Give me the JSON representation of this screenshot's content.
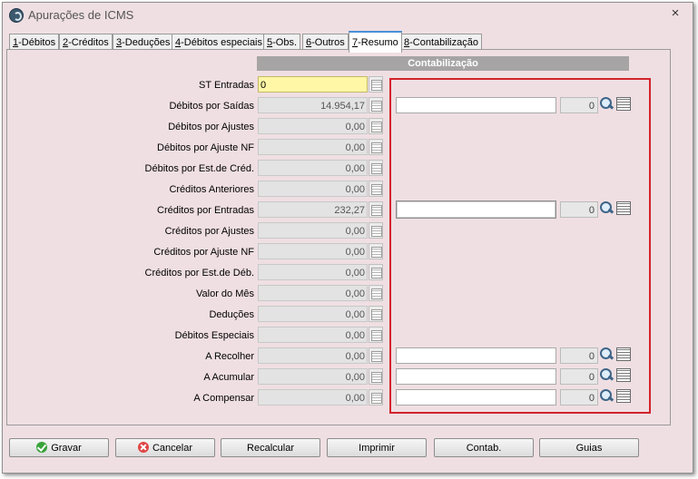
{
  "window": {
    "title": "Apurações de ICMS",
    "close_glyph": "×"
  },
  "tabs": [
    {
      "key": "1",
      "label": "-Débitos"
    },
    {
      "key": "2",
      "label": "-Créditos"
    },
    {
      "key": "3",
      "label": "-Deduções"
    },
    {
      "key": "4",
      "label": "-Débitos especiais"
    },
    {
      "key": "5",
      "label": "-Obs."
    },
    {
      "key": "6",
      "label": "-Outros"
    },
    {
      "key": "7",
      "label": "-Resumo"
    },
    {
      "key": "8",
      "label": "-Contabilização"
    }
  ],
  "active_tab": "7-Resumo",
  "section": {
    "header": "Contabilização"
  },
  "rows": [
    {
      "label": "ST Entradas",
      "value": "0"
    },
    {
      "label": "Débitos por Saídas",
      "value": "14.954,17",
      "account": "",
      "code": "0"
    },
    {
      "label": "Débitos por Ajustes",
      "value": "0,00"
    },
    {
      "label": "Débitos por Ajuste NF",
      "value": "0,00"
    },
    {
      "label": "Débitos por Est.de Créd.",
      "value": "0,00"
    },
    {
      "label": "Créditos Anteriores",
      "value": "0,00"
    },
    {
      "label": "Créditos por Entradas",
      "value": "232,27",
      "account": "",
      "code": "0"
    },
    {
      "label": "Créditos por Ajustes",
      "value": "0,00"
    },
    {
      "label": "Créditos por Ajuste NF",
      "value": "0,00"
    },
    {
      "label": "Créditos por Est.de Déb.",
      "value": "0,00"
    },
    {
      "label": "Valor do Mês",
      "value": "0,00"
    },
    {
      "label": "Deduções",
      "value": "0,00"
    },
    {
      "label": "Débitos Especiais",
      "value": "0,00"
    },
    {
      "label": "A Recolher",
      "value": "0,00",
      "account": "",
      "code": "0"
    },
    {
      "label": "A Acumular",
      "value": "0,00",
      "account": "",
      "code": "0"
    },
    {
      "label": "A Compensar",
      "value": "0,00",
      "account": "",
      "code": "0"
    }
  ],
  "buttons": {
    "gravar": "Gravar",
    "cancelar": "Cancelar",
    "recalcular": "Recalcular",
    "imprimir": "Imprimir",
    "contab": "Contab.",
    "guias": "Guias"
  },
  "colors": {
    "highlight_border": "#d2232a",
    "first_field_bg": "#fff7a6"
  }
}
